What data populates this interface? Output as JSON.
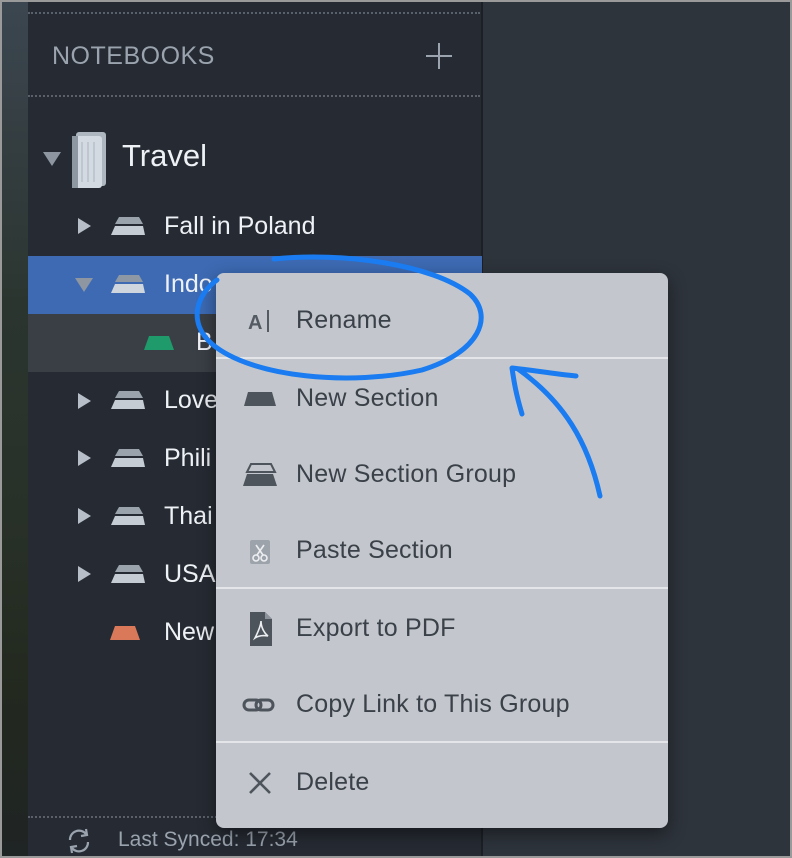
{
  "sidebar": {
    "header": "NOTEBOOKS",
    "notebook": {
      "name": "Travel"
    },
    "items": [
      {
        "label": "Fall in Poland",
        "expanded": false
      },
      {
        "label": "Indo",
        "expanded": true,
        "selected": true
      },
      {
        "label": "B",
        "type": "section",
        "color": "#1f9a6a"
      },
      {
        "label": "Love",
        "expanded": false
      },
      {
        "label": "Phili",
        "expanded": false
      },
      {
        "label": "Thai",
        "expanded": false
      },
      {
        "label": "USA",
        "expanded": false
      },
      {
        "label": "New",
        "type": "section",
        "color": "#d9795a"
      }
    ],
    "footer": {
      "sync_text": "Last Synced: 17:34"
    }
  },
  "context_menu": {
    "items": [
      {
        "label": "Rename",
        "icon": "rename-icon"
      },
      {
        "label": "New Section",
        "icon": "section-icon"
      },
      {
        "label": "New Section Group",
        "icon": "section-group-icon"
      },
      {
        "label": "Paste Section",
        "icon": "paste-icon"
      },
      {
        "label": "Export to PDF",
        "icon": "pdf-icon"
      },
      {
        "label": "Copy Link to This Group",
        "icon": "link-icon"
      },
      {
        "label": "Delete",
        "icon": "close-icon"
      }
    ]
  },
  "colors": {
    "selection": "#3d6ab3",
    "annotation": "#1a7cf0",
    "menu_bg": "#c3c7cd",
    "sidebar_bg": "#262b33"
  }
}
